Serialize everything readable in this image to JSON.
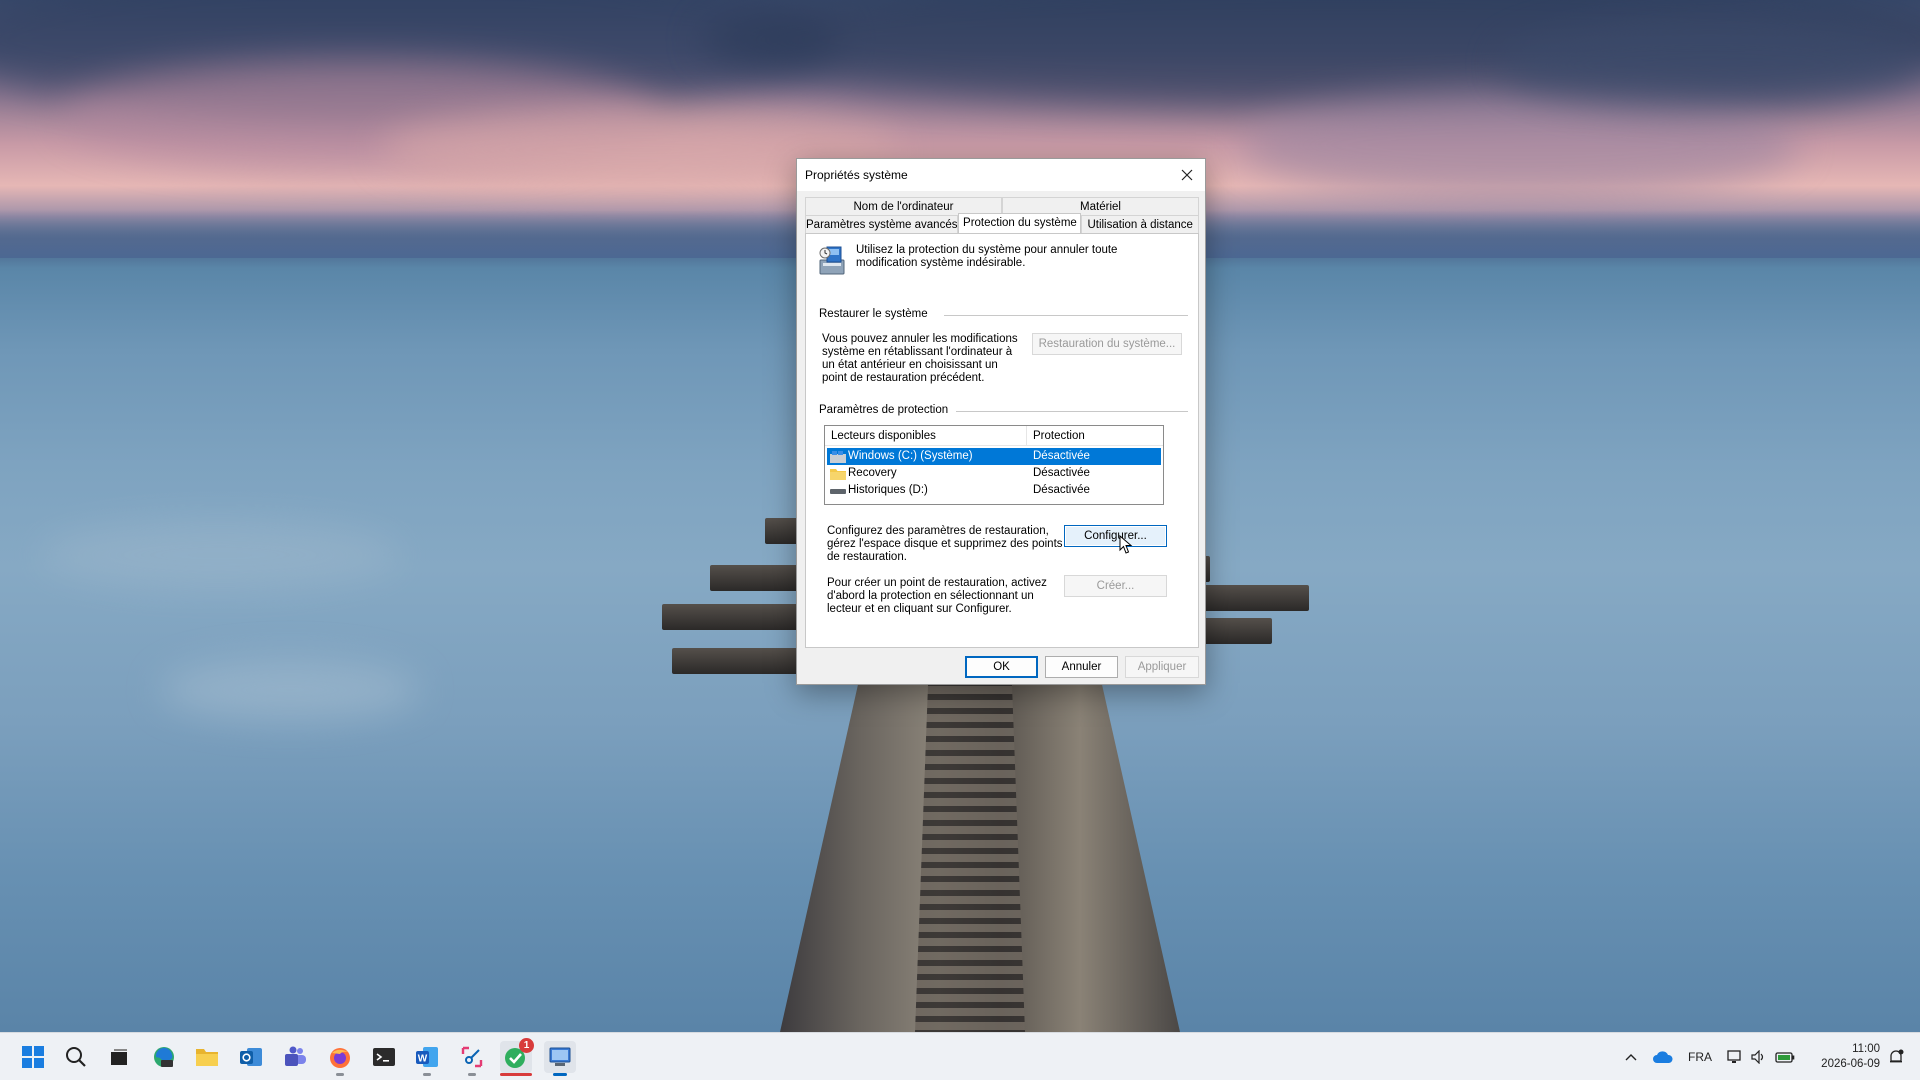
{
  "dialog": {
    "title": "Propriétés système",
    "tabs_row1": [
      "Nom de l'ordinateur",
      "Matériel"
    ],
    "tabs_row2": [
      "Paramètres système avancés",
      "Protection du système",
      "Utilisation à distance"
    ],
    "active_tab": "Protection du système",
    "intro_text": "Utilisez la protection du système pour annuler toute modification système indésirable.",
    "restore_group_label": "Restaurer le système",
    "restore_text": "Vous pouvez annuler les modifications système en rétablissant l'ordinateur à un état antérieur en choisissant un point de restauration précédent.",
    "restore_button": "Restauration du système...",
    "protection_group_label": "Paramètres de protection",
    "drives_columns": [
      "Lecteurs disponibles",
      "Protection"
    ],
    "drives": [
      {
        "name": "Windows (C:) (Système)",
        "protection": "Désactivée",
        "selected": true,
        "icon": "windows-drive-icon"
      },
      {
        "name": "Recovery",
        "protection": "Désactivée",
        "selected": false,
        "icon": "folder-icon"
      },
      {
        "name": "Historiques (D:)",
        "protection": "Désactivée",
        "selected": false,
        "icon": "drive-icon"
      }
    ],
    "configure_text": "Configurez des paramètres de restauration, gérez l'espace disque et supprimez des points de restauration.",
    "configure_button": "Configurer...",
    "create_text": "Pour créer un point de restauration, activez d'abord la protection en sélectionnant un lecteur et en cliquant sur Configurer.",
    "create_button": "Créer...",
    "ok_button": "OK",
    "cancel_button": "Annuler",
    "apply_button": "Appliquer"
  },
  "taskbar": {
    "apps": [
      "start-icon",
      "search-icon",
      "task-view-icon",
      "edge-icon",
      "file-explorer-icon",
      "outlook-icon",
      "teams-icon",
      "firefox-icon",
      "terminal-icon",
      "word-icon",
      "snipping-tool-icon",
      "app-with-badge-icon",
      "system-properties-icon"
    ],
    "badge_count": "1",
    "tray_language": "FRA",
    "time": "11:00",
    "date": "2026-06-09"
  },
  "colors": {
    "accent": "#0067c0",
    "selection": "#0078d7"
  }
}
